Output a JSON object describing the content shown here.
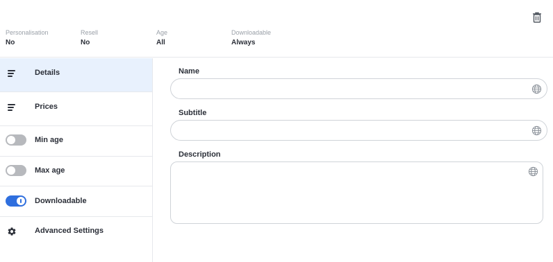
{
  "header": {
    "meta": [
      {
        "label": "Personalisation",
        "value": "No"
      },
      {
        "label": "Resell",
        "value": "No"
      },
      {
        "label": "Age",
        "value": "All"
      },
      {
        "label": "Downloadable",
        "value": "Always"
      }
    ]
  },
  "sidebar": {
    "items": [
      {
        "label": "Details",
        "icon": "lines-icon",
        "active": true
      },
      {
        "label": "Prices",
        "icon": "lines-icon"
      },
      {
        "label": "Min age",
        "toggle": "off"
      },
      {
        "label": "Max age",
        "toggle": "off"
      },
      {
        "label": "Downloadable",
        "toggle": "on"
      },
      {
        "label": "Advanced Settings",
        "icon": "gear-icon"
      }
    ]
  },
  "form": {
    "name": {
      "label": "Name",
      "value": ""
    },
    "subtitle": {
      "label": "Subtitle",
      "value": ""
    },
    "description": {
      "label": "Description",
      "value": ""
    }
  },
  "colors": {
    "accent": "#2f6fde",
    "active_bg": "#e8f1fd",
    "toggle_off": "#b7b9bd",
    "border": "#cfd3d8"
  }
}
